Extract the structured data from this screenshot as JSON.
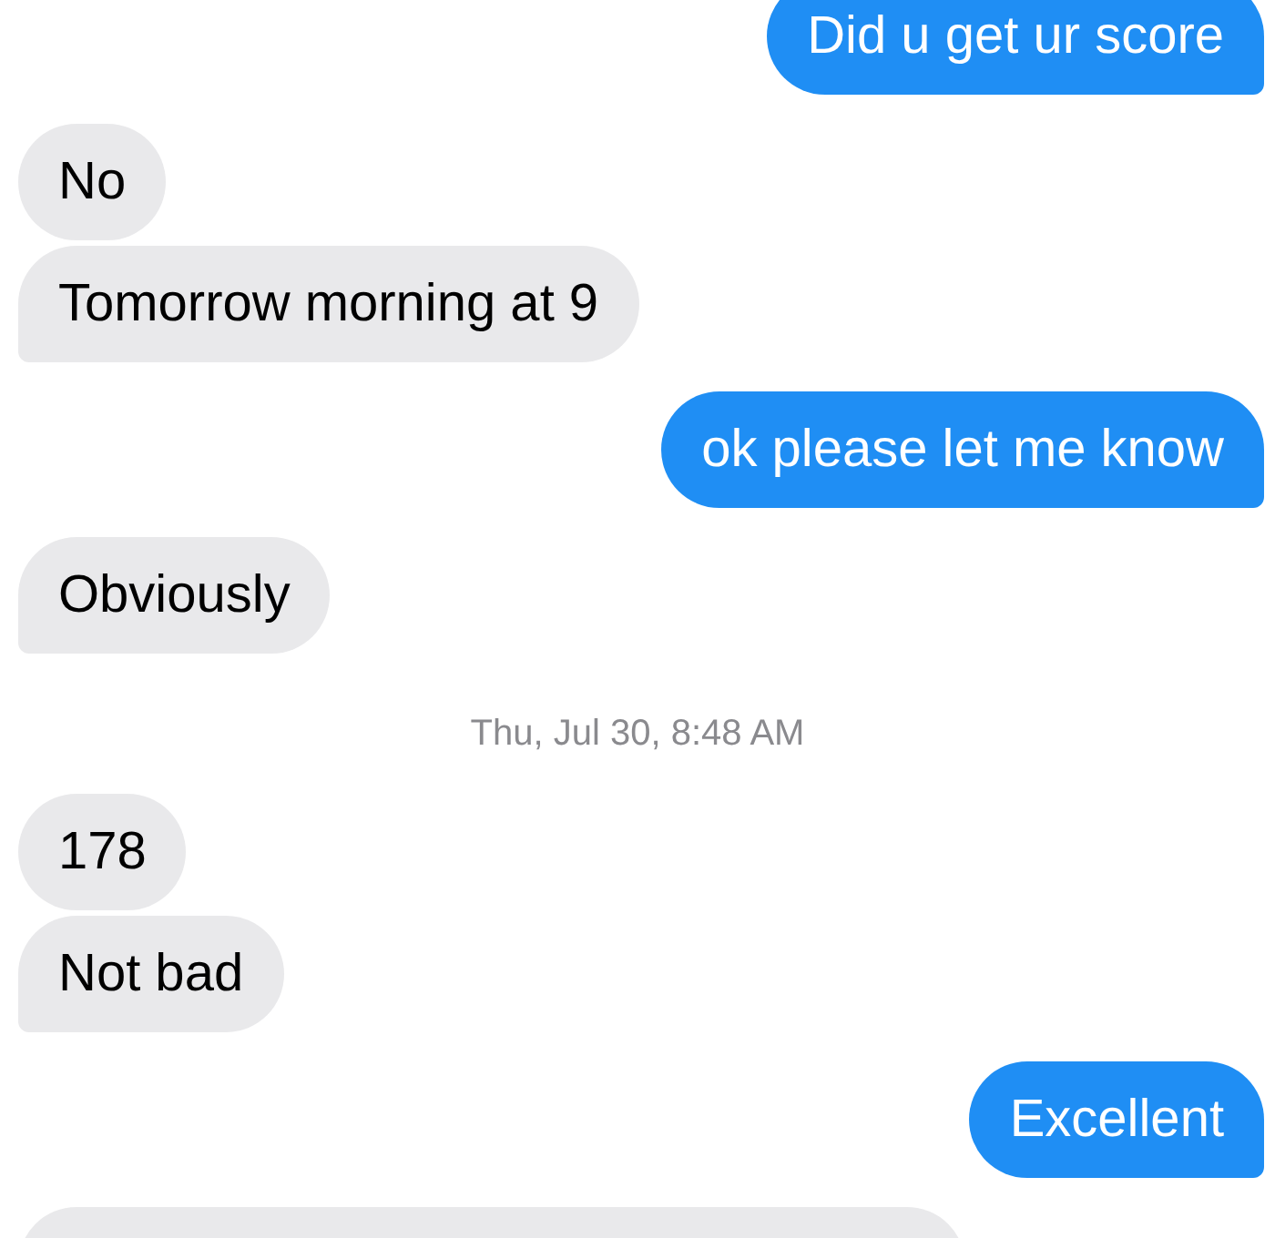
{
  "messages": [
    {
      "kind": "sent",
      "text": "Did u get ur score",
      "tail": true
    },
    {
      "kind": "received",
      "text": "No",
      "tail": false
    },
    {
      "kind": "received",
      "text": "Tomorrow morning at 9",
      "tail": true
    },
    {
      "kind": "sent",
      "text": "ok please let me know",
      "tail": true
    },
    {
      "kind": "received",
      "text": "Obviously",
      "tail": true
    },
    {
      "kind": "timestamp",
      "text": "Thu, Jul 30, 8:48 AM"
    },
    {
      "kind": "received",
      "text": "178",
      "tail": false
    },
    {
      "kind": "received",
      "text": "Not bad",
      "tail": true
    },
    {
      "kind": "sent",
      "text": "Excellent",
      "tail": true
    },
    {
      "kind": "received-cut"
    }
  ]
}
